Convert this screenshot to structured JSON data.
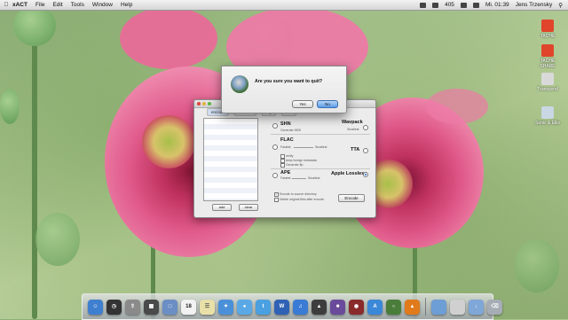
{
  "menubar": {
    "app_name": "xACT",
    "items": [
      "File",
      "Edit",
      "Tools",
      "Window",
      "Help"
    ],
    "battery": "405",
    "clock": "Mi. 01:39",
    "user": "Jens Trzensky"
  },
  "desktop_icons": [
    {
      "label": "TACHE",
      "color": "#e0452b"
    },
    {
      "label": "TACHE SHARE",
      "color": "#e0452b"
    },
    {
      "label": "Transcend",
      "color": "#d9d9d9"
    },
    {
      "label": "Sonic & Ellis",
      "color": "#c9d6e4"
    }
  ],
  "xact_window": {
    "tabs": [
      "encode",
      "decode",
      "tag",
      "cue"
    ],
    "add_label": "add",
    "clear_label": "clear",
    "shn_label": "SHN",
    "shn_sub": "Generate MD5",
    "wavpack_label": "Wavpack",
    "wavpack_sub": "Smallest",
    "flac_label": "FLAC",
    "flac_fastest": "Fastest",
    "flac_smallest": "Smallest",
    "tta_label": "TTA",
    "ape_label": "APE",
    "apple_lossless_label": "Apple Lossless",
    "ape_fastest": "Fastest",
    "ape_smallest": "Smallest",
    "flac_opt1": "verify",
    "flac_opt2": "keep foreign metadata",
    "flac_opt3": "Generate ffp",
    "encode_to_source": "Encode to source directory",
    "delete_original": "Delete original files after encode",
    "encode_label": "Encode"
  },
  "dialog": {
    "message": "Are you sure you want to quit?",
    "yes_label": "Yes",
    "no_label": "No",
    "accent": "#5a9be6"
  },
  "dock": {
    "icons": [
      {
        "name": "finder-icon",
        "color": "#3f7fd0"
      },
      {
        "name": "dashboard-icon",
        "color": "#333333"
      },
      {
        "name": "launchpad-icon",
        "color": "#8a8a8a"
      },
      {
        "name": "mission-control-icon",
        "color": "#4a4a4a"
      },
      {
        "name": "preview-icon",
        "color": "#6b8fc4"
      },
      {
        "name": "calendar-icon",
        "color": "#f2f2f2"
      },
      {
        "name": "notes-icon",
        "color": "#e9e0a8"
      },
      {
        "name": "safari-icon",
        "color": "#4a90d9"
      },
      {
        "name": "messages-icon",
        "color": "#5aa9e6"
      },
      {
        "name": "twitter-icon",
        "color": "#4aa0e0"
      },
      {
        "name": "word-icon",
        "color": "#2f62b5"
      },
      {
        "name": "itunes-icon",
        "color": "#3a7bd5"
      },
      {
        "name": "photo-icon",
        "color": "#3d3d3d"
      },
      {
        "name": "gallery-icon",
        "color": "#6a4a9a"
      },
      {
        "name": "photobooth-icon",
        "color": "#8a2a2a"
      },
      {
        "name": "app-store-icon",
        "color": "#3b87d8"
      },
      {
        "name": "xact-icon",
        "color": "#4a7d3a"
      },
      {
        "name": "vlc-icon",
        "color": "#e07a1a"
      },
      {
        "name": "folder-icon",
        "color": "#6d9ed6"
      },
      {
        "name": "documents-icon",
        "color": "#d0d0d0"
      },
      {
        "name": "downloads-icon",
        "color": "#7fa7d8"
      },
      {
        "name": "trash-icon",
        "color": "#a7adb5"
      }
    ],
    "calendar_day": "18",
    "twitter_glyph": "t",
    "word_glyph": "W"
  }
}
